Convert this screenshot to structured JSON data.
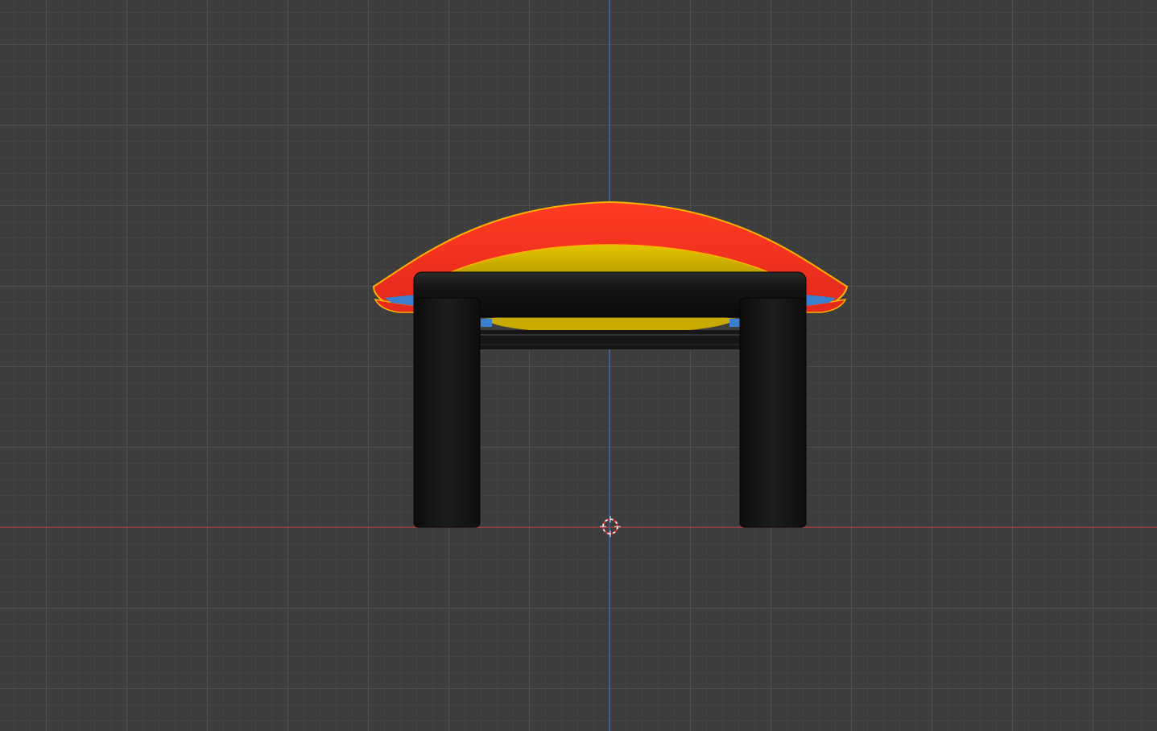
{
  "viewport": {
    "background_color": "#3d3d3d",
    "x_axis_color": "#b13a3a",
    "z_axis_color": "#3d6cb8"
  },
  "object": {
    "icon": "3d-footstool-model-icon",
    "cushion_top_color": "#f03020",
    "cushion_bottom_color": "#d8c000",
    "accent_color": "#3a7fd0",
    "frame_color": "#111111"
  },
  "cursor": {
    "icon": "3d-cursor-icon"
  }
}
